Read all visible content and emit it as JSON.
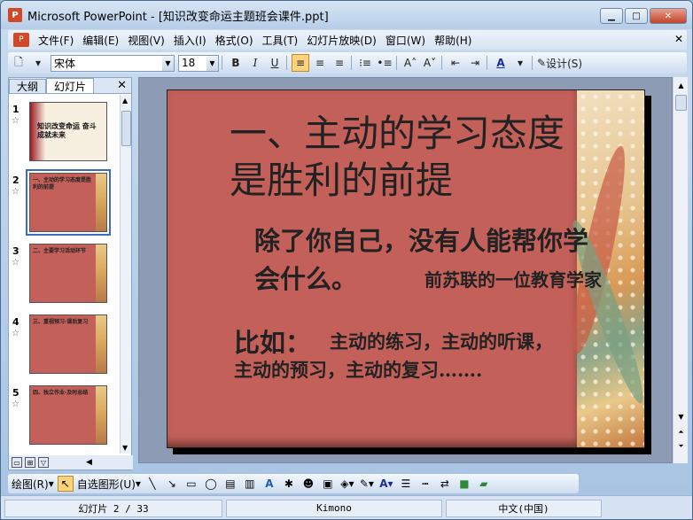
{
  "window": {
    "title": "Microsoft PowerPoint - [知识改变命运主题班会课件.ppt]",
    "app_icon": "P"
  },
  "menubar": {
    "items": [
      "文件(F)",
      "编辑(E)",
      "视图(V)",
      "插入(I)",
      "格式(O)",
      "工具(T)",
      "幻灯片放映(D)",
      "窗口(W)",
      "帮助(H)"
    ],
    "close_glyph": "✕"
  },
  "toolbar": {
    "font": "宋体",
    "size": "18",
    "bold": "B",
    "italic": "I",
    "underline": "U",
    "design_label": "设计(S)"
  },
  "left_pane": {
    "tabs": [
      "大纲",
      "幻灯片"
    ],
    "slides": [
      {
        "num": "1",
        "text": "知识改变命运 奋斗成就未来"
      },
      {
        "num": "2",
        "text": "一、主动的学习态度是胜利的前提"
      },
      {
        "num": "3",
        "text": "二、主要学习活动环节"
      },
      {
        "num": "4",
        "text": "三、重视预习·课后复习"
      },
      {
        "num": "5",
        "text": "四、独立作业·及时总结"
      }
    ]
  },
  "slide": {
    "heading": "一、主动的学习态度是胜利的前提",
    "quote_line1": "除了你自己，没有人能帮你学",
    "quote_line2": "会什么。",
    "quote_source": "前苏联的一位教育学家",
    "example_label": "比如：",
    "example_line1": "主动的练习，主动的听课，",
    "example_line2": "主动的预习，主动的复习……."
  },
  "drawbar": {
    "draw_label": "绘图(R)",
    "autoshape_label": "自选图形(U)"
  },
  "statusbar": {
    "slide_indicator": "幻灯片 2 / 33",
    "design": "Kimono",
    "language": "中文(中国)"
  }
}
